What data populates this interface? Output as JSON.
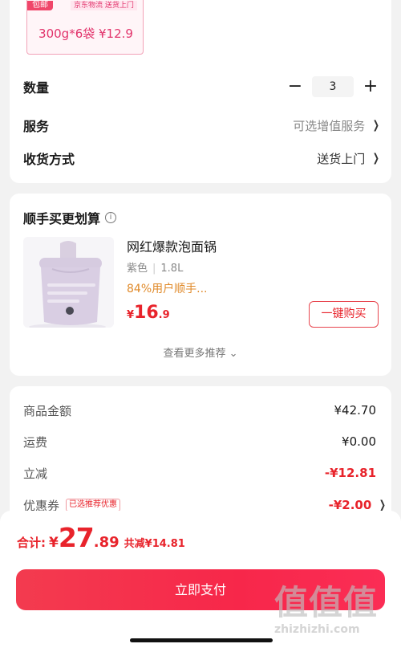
{
  "top_card": {
    "spec_tag": "包邮",
    "spec_sub": "京东物流  送货上门",
    "spec_option": "300g*6袋 ¥12.9",
    "quantity_label": "数量",
    "quantity_minus": "−",
    "quantity_value": "3",
    "quantity_plus": "+",
    "service_label": "服务",
    "service_value": "可选增值服务",
    "delivery_label": "收货方式",
    "delivery_value": "送货上门"
  },
  "bundle": {
    "title": "顺手买更划算",
    "info_icon": "i",
    "product_name": "网红爆款泡面锅",
    "product_color": "紫色",
    "product_size": "1.8L",
    "product_note": "84%用户顺手...",
    "price_currency": "¥",
    "price_int": "16",
    "price_dec": ".9",
    "buy_button": "一键购买",
    "more_label": "查看更多推荐",
    "more_chevron": "⌄"
  },
  "summary": {
    "goods_label": "商品金额",
    "goods_value": "¥42.70",
    "shipping_label": "运费",
    "shipping_value": "¥0.00",
    "discount_label": "立减",
    "discount_value": "-¥12.81",
    "coupon_label": "优惠券",
    "coupon_tag": "已选推荐优惠",
    "coupon_value": "-¥2.00"
  },
  "bottom_bar": {
    "total_label": "合计:",
    "total_currency": "¥",
    "total_int": "27",
    "total_dec": ".89",
    "total_saved": "共减¥14.81",
    "pay_button": "立即支付"
  },
  "watermark": {
    "mark": "值值值",
    "site": "zhizhizhi.com"
  },
  "icons": {
    "chevron": "chevron-right-icon",
    "info": "info-icon"
  },
  "colors": {
    "accent_red": "#e8232b",
    "spec_pink": "#e2336b",
    "note_orange": "#e08a2a"
  }
}
